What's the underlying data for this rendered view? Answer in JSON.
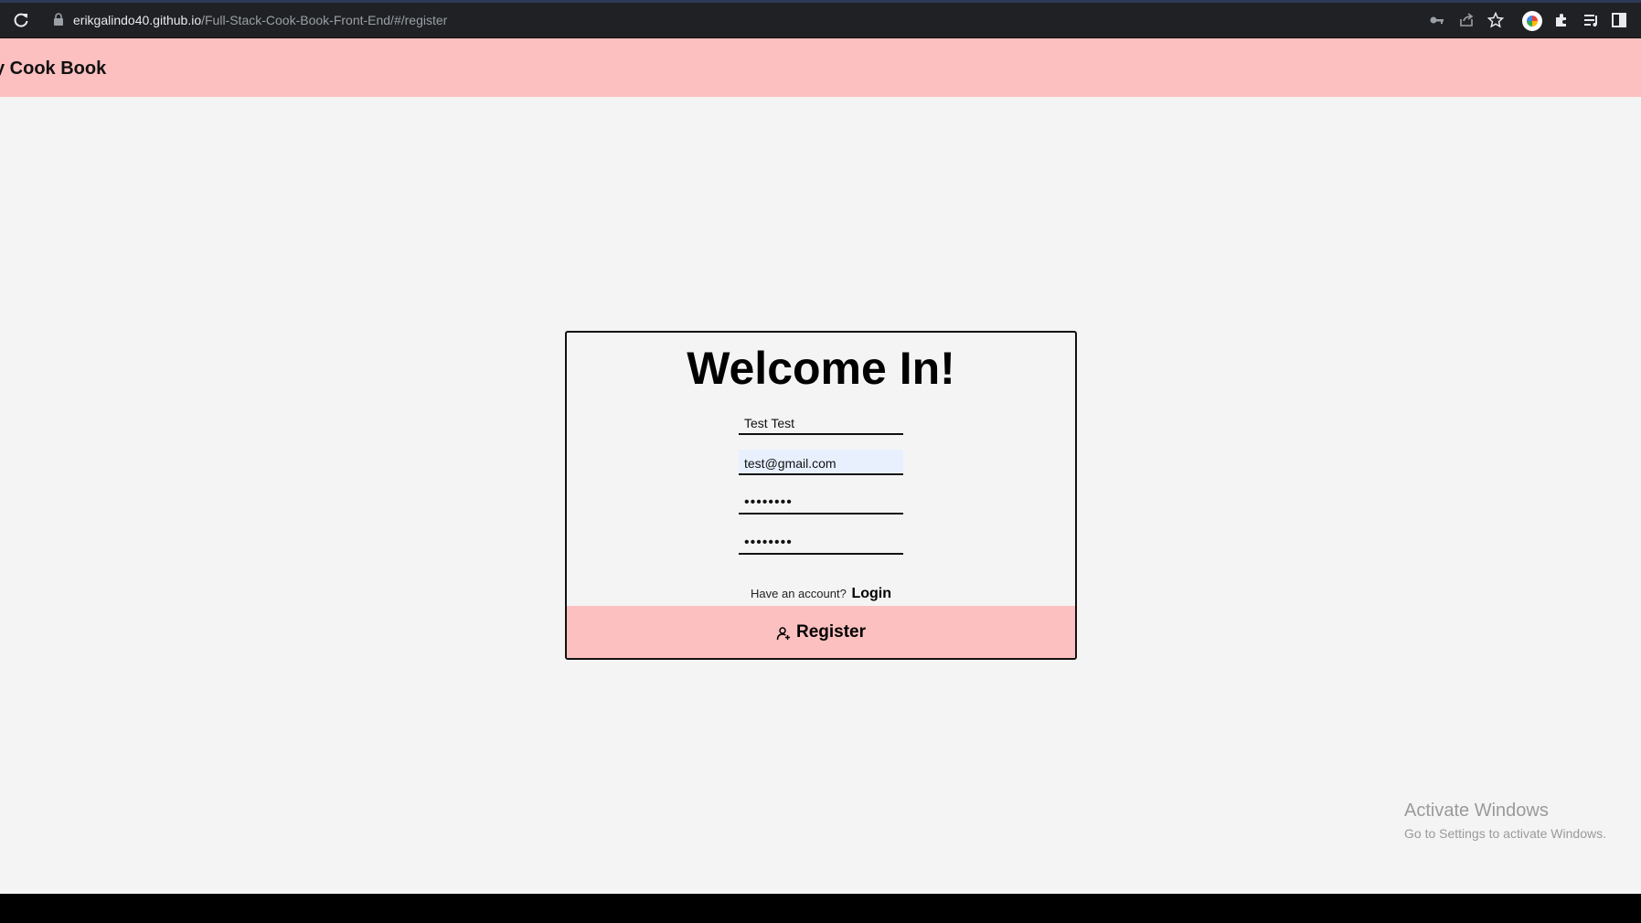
{
  "browser": {
    "url_host": "erikgalindo40.github.io",
    "url_path": "/Full-Stack-Cook-Book-Front-End/#/register"
  },
  "header": {
    "title": "y Cook Book"
  },
  "card": {
    "title": "Welcome In!",
    "name_value": "Test Test",
    "email_value": "test@gmail.com",
    "password_value": "••••••••",
    "confirm_password_value": "••••••••",
    "have_account_text": "Have an account?",
    "login_label": "Login",
    "register_label": "Register"
  },
  "watermark": {
    "title": "Activate Windows",
    "subtitle": "Go to Settings to activate Windows."
  },
  "colors": {
    "accent_pink": "#fdc0c0",
    "page_bg": "#f4f4f4",
    "chrome_bg": "#202124"
  },
  "icons": [
    "reload-icon",
    "lock-icon",
    "key-icon",
    "share-icon",
    "star-icon",
    "profile-icon",
    "extensions-icon",
    "reading-list-icon",
    "side-panel-icon",
    "add-user-icon"
  ]
}
